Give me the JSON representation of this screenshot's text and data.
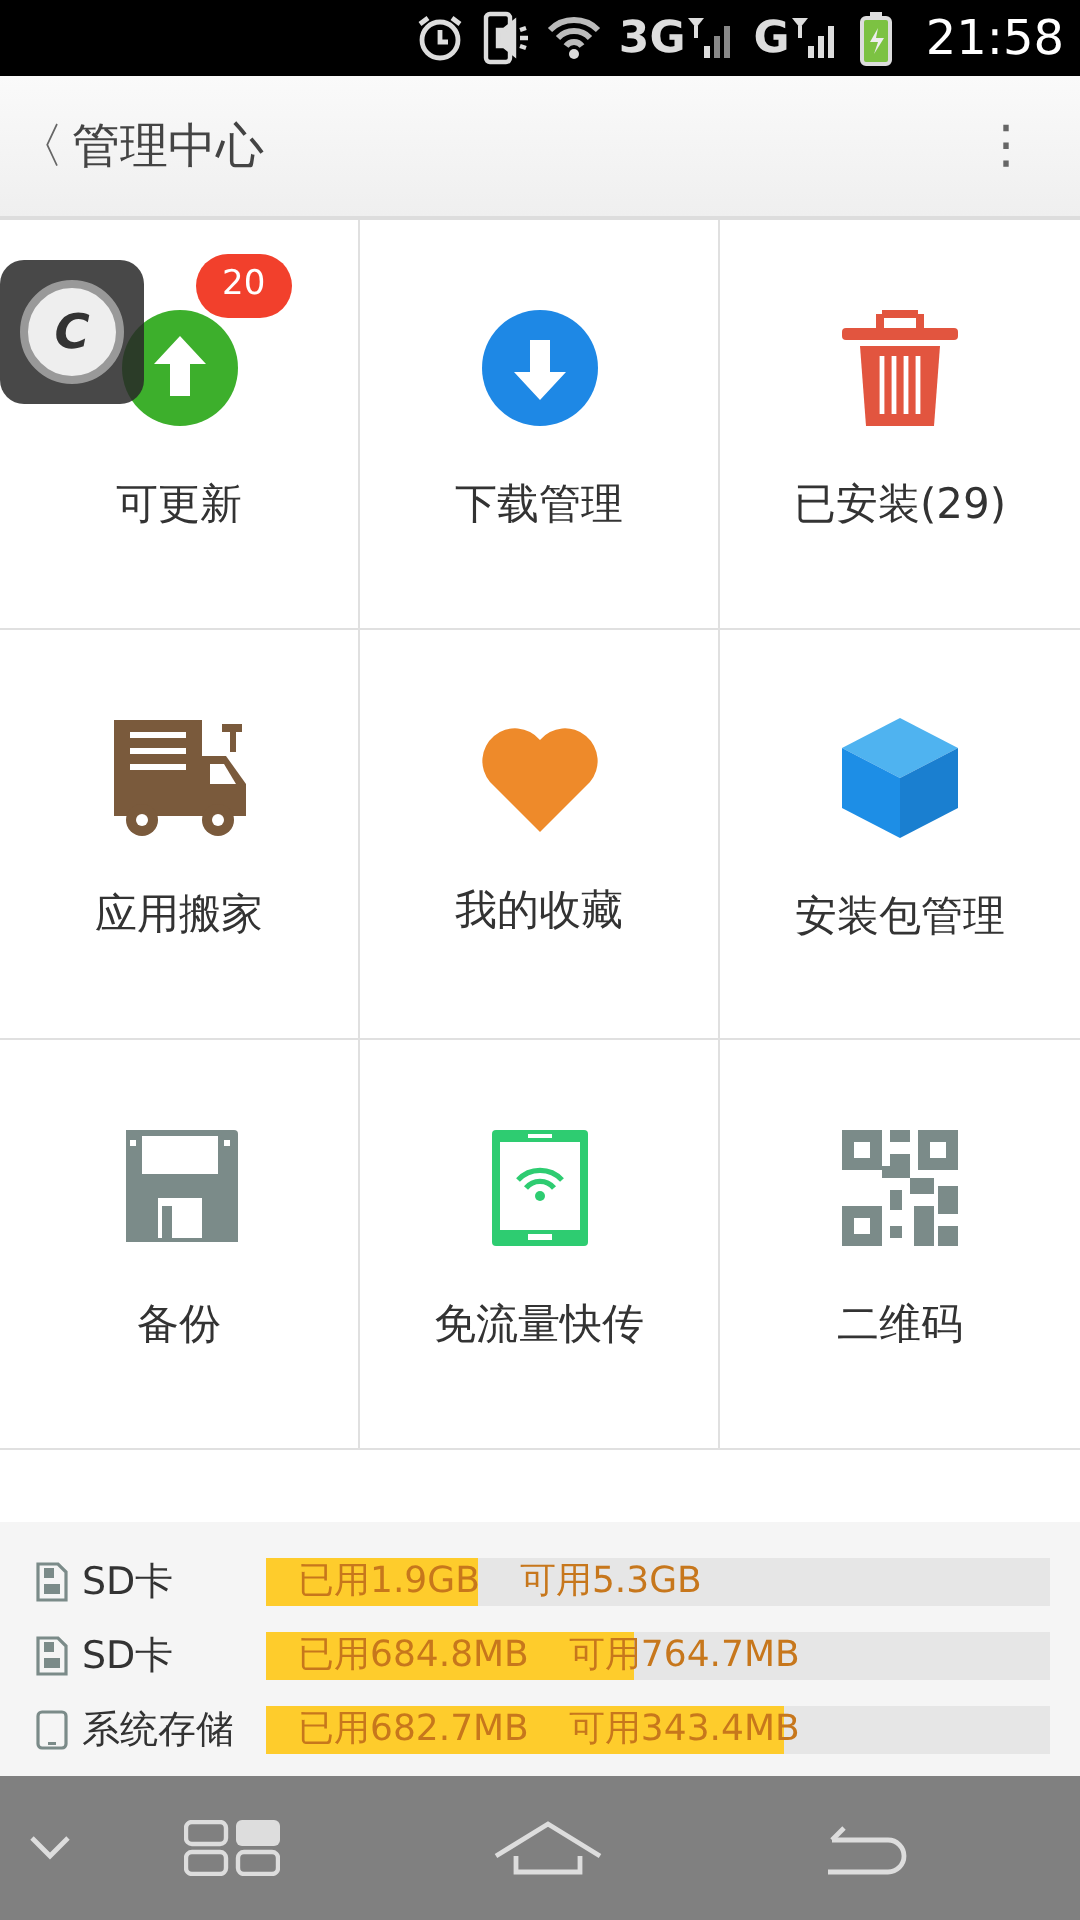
{
  "status_bar": {
    "network_1": "3G",
    "network_2": "G",
    "time": "21:58"
  },
  "header": {
    "back": "〈",
    "title": "管理中心",
    "menu": "⋮"
  },
  "tiles": [
    {
      "kind": "update",
      "label": "可更新",
      "badge": "20"
    },
    {
      "kind": "download",
      "label": "下载管理"
    },
    {
      "kind": "trash",
      "label": "已安装(29)"
    },
    {
      "kind": "truck",
      "label": "应用搬家"
    },
    {
      "kind": "heart",
      "label": "我的收藏"
    },
    {
      "kind": "box",
      "label": "安装包管理"
    },
    {
      "kind": "floppy",
      "label": "备份"
    },
    {
      "kind": "tablet",
      "label": "免流量快传"
    },
    {
      "kind": "qr",
      "label": "二维码"
    }
  ],
  "storage": [
    {
      "kind": "sd",
      "name": "SD卡",
      "used": "已用1.9GB",
      "free": "可用5.3GB",
      "level": 0.27
    },
    {
      "kind": "sd",
      "name": "SD卡",
      "used": "已用684.8MB",
      "free": "可用764.7MB",
      "level": 0.47
    },
    {
      "kind": "phone",
      "name": "系统存储",
      "used": "已用682.7MB",
      "free": "可用343.4MB",
      "level": 0.66
    }
  ],
  "floating_button": {
    "letter": "C"
  }
}
